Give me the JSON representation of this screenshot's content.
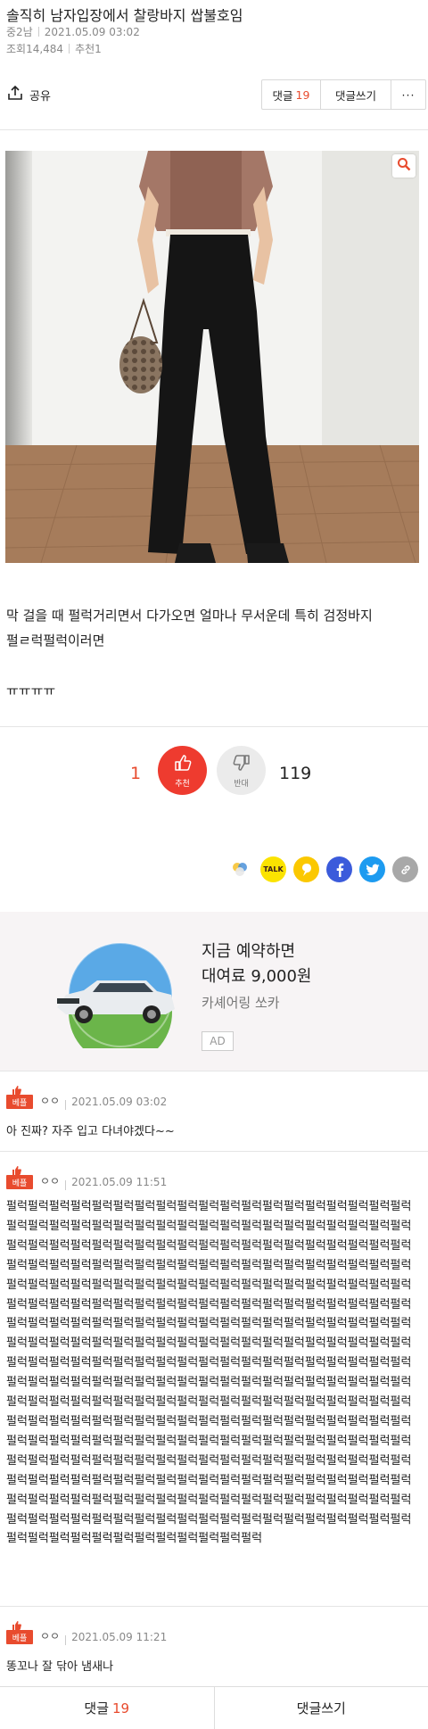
{
  "post": {
    "title": "솔직히 남자입장에서 찰랑바지 쌉불호임",
    "author": "중2남",
    "datetime": "2021.05.09 03:02",
    "views": "조회14,484",
    "recommends": "추천1"
  },
  "toolbar": {
    "share_label": "공유",
    "comments_label": "댓글",
    "comments_count": "19",
    "write_comment_label": "댓글쓰기",
    "more_label": "···"
  },
  "content": {
    "line1": "막 걸을 때 펄럭거리면서 다가오면 얼마나 무서운데 특히 검정바지",
    "line2": "펄ㄹ럭펄럭이러면",
    "line3": "ㅠㅠㅠㅠ"
  },
  "vote": {
    "up_count": "1",
    "up_label": "추천",
    "down_label": "반대",
    "down_count": "119"
  },
  "share_icons": [
    "story-icon",
    "kakaotalk-icon",
    "kakaostory-icon",
    "facebook-icon",
    "twitter-icon",
    "link-icon"
  ],
  "share_talk_text": "TALK",
  "ad": {
    "line1": "지금 예약하면",
    "line2": "대여료 9,000원",
    "brand": "카셰어링 쏘카",
    "badge": "AD"
  },
  "comments": [
    {
      "badge": "베플",
      "name": "ㅇㅇ",
      "date": "2021.05.09 03:02",
      "text": "아 진짜? 자주 입고 다녀야겠다~~"
    },
    {
      "badge": "베플",
      "name": "ㅇㅇ",
      "date": "2021.05.09 11:51",
      "text": "펄럭펄럭펄럭펄럭펄럭펄럭펄럭펄럭펄럭펄럭펄럭펄럭펄럭펄럭펄럭펄럭펄럭펄럭펄럭펄럭펄럭펄럭펄럭펄럭펄럭펄럭펄럭펄럭펄럭펄럭펄럭펄럭펄럭펄럭펄럭펄럭펄럭펄럭펄럭펄럭펄럭펄럭펄럭펄럭펄럭펄럭펄럭펄럭펄럭펄럭펄럭펄럭펄럭펄럭펄럭펄럭펄럭펄럭펄럭펄럭펄럭펄럭펄럭펄럭펄럭펄럭펄럭펄럭펄럭펄럭펄럭펄럭펄럭펄럭펄럭펄럭펄럭펄럭펄럭펄럭펄럭펄럭펄럭펄럭펄럭펄럭펄럭펄럭펄럭펄럭펄럭펄럭펄럭펄럭펄럭펄럭펄럭펄럭펄럭펄럭펄럭펄럭펄럭펄럭펄럭펄럭펄럭펄럭펄럭펄럭펄럭펄럭펄럭펄럭펄럭펄럭펄럭펄럭펄럭펄럭펄럭펄럭펄럭펄럭펄럭펄럭펄럭펄럭펄럭펄럭펄럭펄럭펄럭펄럭펄럭펄럭펄럭펄럭펄럭펄럭펄럭펄럭펄럭펄럭펄럭펄럭펄럭펄럭펄럭펄럭펄럭펄럭펄럭펄럭펄럭펄럭펄럭펄럭펄럭펄럭펄럭펄럭펄럭펄럭펄럭펄럭펄럭펄럭펄럭펄럭펄럭펄럭펄럭펄럭펄럭펄럭펄럭펄럭펄럭펄럭펄럭펄럭펄럭펄럭펄럭펄럭펄럭펄럭펄럭펄럭펄럭펄럭펄럭펄럭펄럭펄럭펄럭펄럭펄럭펄럭펄럭펄럭펄럭펄럭펄럭펄럭펄럭펄럭펄럭펄럭펄럭펄럭펄럭펄럭펄럭펄럭펄럭펄럭펄럭펄럭펄럭펄럭펄럭펄럭펄럭펄럭펄럭펄럭펄럭펄럭펄럭펄럭펄럭펄럭펄럭펄럭펄럭펄럭펄럭펄럭펄럭펄럭펄럭펄럭펄럭펄럭펄럭펄럭펄럭펄럭펄럭펄럭펄럭펄럭펄럭펄럭펄럭펄럭펄럭펄럭펄럭펄럭펄럭펄럭펄럭펄럭펄럭펄럭펄럭펄럭펄럭펄럭펄럭펄럭펄럭펄럭펄럭펄럭펄럭펄럭펄럭펄럭펄럭펄럭펄럭펄럭펄럭펄럭펄럭펄럭펄럭펄럭펄럭펄럭펄럭펄럭펄럭펄럭펄럭펄럭펄럭펄럭펄럭펄럭펄럭펄럭펄럭펄럭펄럭펄럭펄럭펄럭펄럭펄럭펄럭펄럭펄럭펄럭펄럭펄럭펄럭펄럭펄럭펄럭펄럭펄럭펄럭펄럭펄럭펄럭펄럭펄럭펄럭펄럭펄럭"
    },
    {
      "badge": "베플",
      "name": "ㅇㅇ",
      "date": "2021.05.09 11:21",
      "text": "똥꼬나 잘 닦아 냄새나"
    }
  ],
  "bottom_bar": {
    "comments_label": "댓글",
    "comments_count": "19",
    "write_label": "댓글쓰기"
  },
  "colors": {
    "accent": "#e84b2e",
    "vote_up": "#ee3b2f",
    "ad_background": "#f7f4f5"
  }
}
